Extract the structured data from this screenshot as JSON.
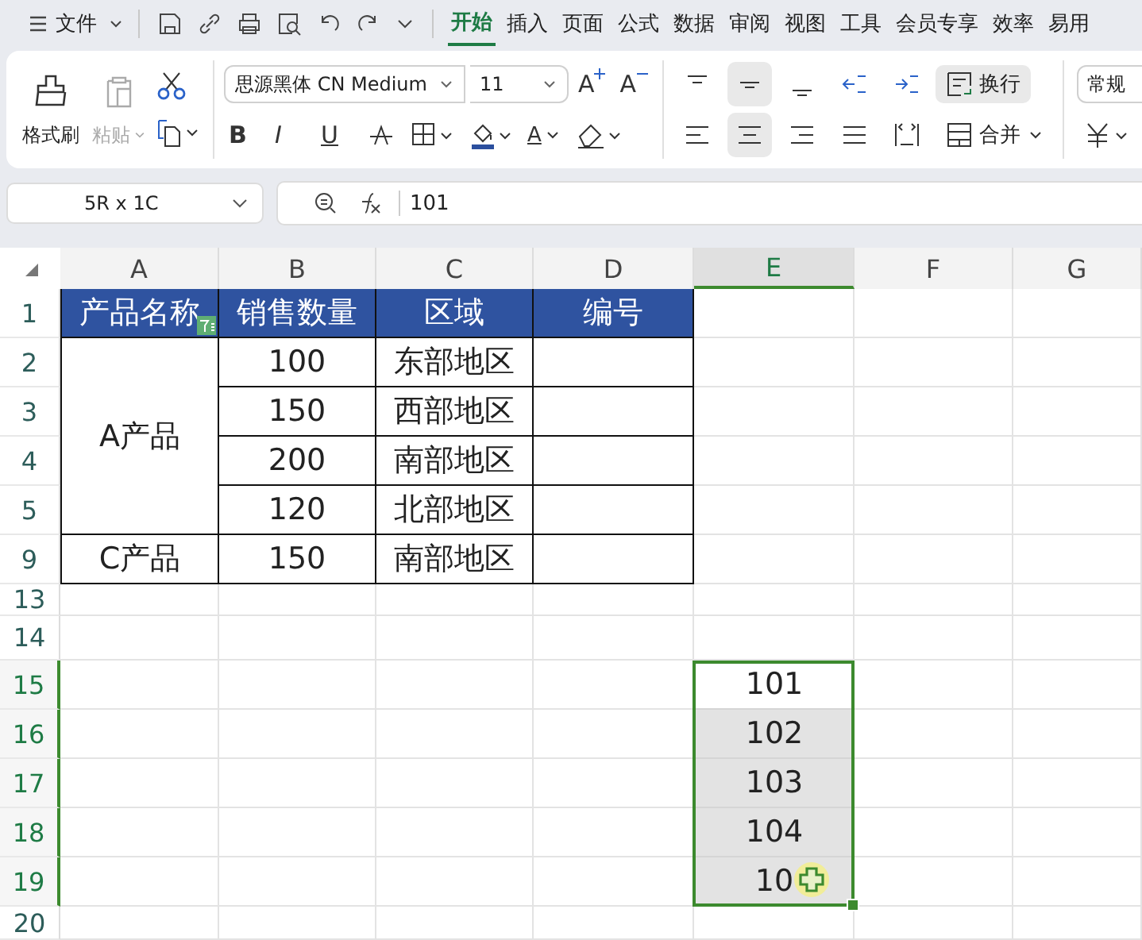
{
  "menu_bar": {
    "file_menu": "文件",
    "tabs": [
      {
        "label": "开始",
        "selected": true
      },
      {
        "label": "插入",
        "selected": false
      },
      {
        "label": "页面",
        "selected": false
      },
      {
        "label": "公式",
        "selected": false
      },
      {
        "label": "数据",
        "selected": false
      },
      {
        "label": "审阅",
        "selected": false
      },
      {
        "label": "视图",
        "selected": false
      },
      {
        "label": "工具",
        "selected": false
      },
      {
        "label": "会员专享",
        "selected": false
      },
      {
        "label": "效率",
        "selected": false
      },
      {
        "label": "易用",
        "selected": false
      }
    ]
  },
  "ribbon": {
    "clipboard": {
      "format_painter": "格式刷",
      "paste": {
        "label": "粘贴",
        "disabled": true
      }
    },
    "font": {
      "family": "思源黑体 CN Medium",
      "size": "11",
      "grow": "A",
      "shrink": "A",
      "bold": "B",
      "italic": "I",
      "underline": "U",
      "font_color_label": "A"
    },
    "alignment": {
      "vertical": [
        {
          "kind": "top",
          "selected": false
        },
        {
          "kind": "middle",
          "selected": true
        },
        {
          "kind": "bottom",
          "selected": false
        }
      ],
      "wrap": {
        "label": "换行",
        "selected": true
      },
      "horizontal": [
        {
          "kind": "left",
          "selected": false
        },
        {
          "kind": "center",
          "selected": true
        },
        {
          "kind": "right",
          "selected": false
        },
        {
          "kind": "justify",
          "selected": false
        },
        {
          "kind": "distributed",
          "selected": false
        }
      ],
      "merge": "合并"
    },
    "number": {
      "format": "常规"
    }
  },
  "name_box": "5R x 1C",
  "formula": "101",
  "sheet": {
    "columns": [
      {
        "label": "A",
        "selected": false
      },
      {
        "label": "B",
        "selected": false
      },
      {
        "label": "C",
        "selected": false
      },
      {
        "label": "D",
        "selected": false
      },
      {
        "label": "E",
        "selected": true
      },
      {
        "label": "F",
        "selected": false
      },
      {
        "label": "G",
        "selected": false
      }
    ],
    "rows": [
      {
        "label": "1",
        "selected": false
      },
      {
        "label": "2",
        "selected": false
      },
      {
        "label": "3",
        "selected": false
      },
      {
        "label": "4",
        "selected": false
      },
      {
        "label": "5",
        "selected": false
      },
      {
        "label": "9",
        "selected": false
      },
      {
        "label": "13",
        "selected": false
      },
      {
        "label": "14",
        "selected": false
      },
      {
        "label": "15",
        "selected": true
      },
      {
        "label": "16",
        "selected": true
      },
      {
        "label": "17",
        "selected": true
      },
      {
        "label": "18",
        "selected": true
      },
      {
        "label": "19",
        "selected": true
      },
      {
        "label": "20",
        "selected": false
      }
    ],
    "table": {
      "headers": [
        "产品名称",
        "销售数量",
        "区域",
        "编号"
      ],
      "groups": [
        {
          "product": "A产品",
          "rows": [
            {
              "quantity": "100",
              "region": "东部地区"
            },
            {
              "quantity": "150",
              "region": "西部地区"
            },
            {
              "quantity": "200",
              "region": "南部地区"
            },
            {
              "quantity": "120",
              "region": "北部地区"
            }
          ]
        },
        {
          "product": "C产品",
          "rows": [
            {
              "quantity": "150",
              "region": "南部地区"
            }
          ]
        }
      ]
    },
    "selection": [
      {
        "text": "101",
        "active": true
      },
      {
        "text": "102",
        "active": false
      },
      {
        "text": "103",
        "active": false
      },
      {
        "text": "104",
        "active": false
      },
      {
        "text": "10",
        "active": false
      }
    ]
  }
}
